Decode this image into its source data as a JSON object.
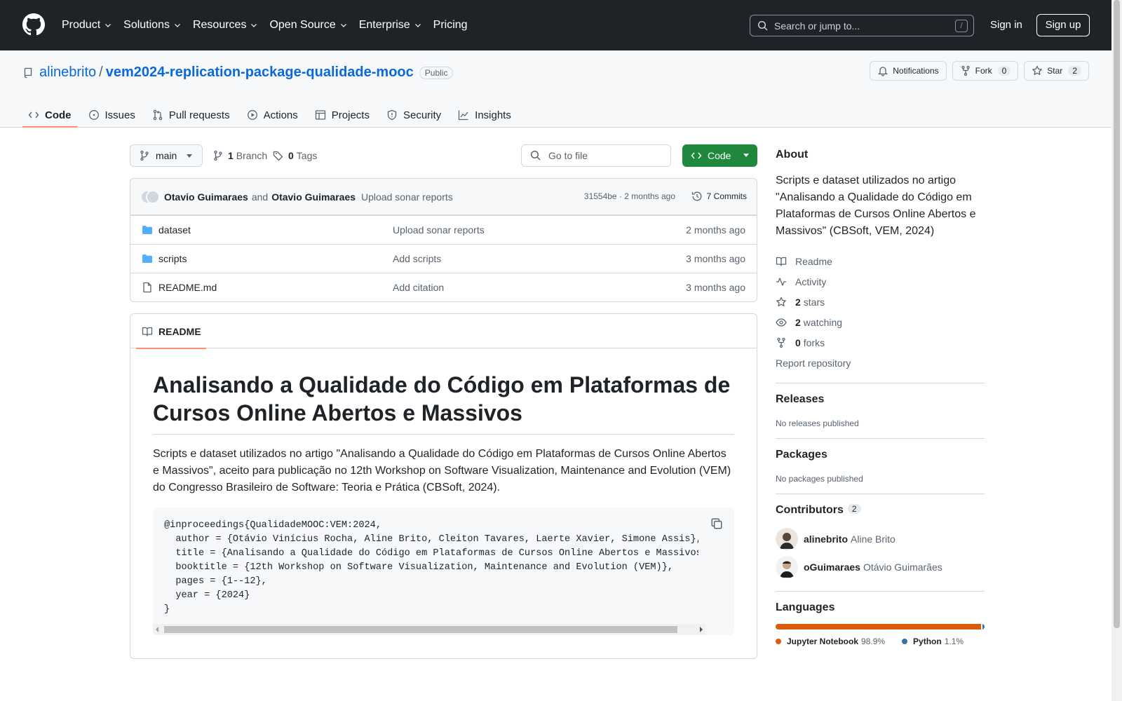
{
  "header": {
    "nav": [
      "Product",
      "Solutions",
      "Resources",
      "Open Source",
      "Enterprise",
      "Pricing"
    ],
    "search_placeholder": "Search or jump to...",
    "search_kbd": "/",
    "signin": "Sign in",
    "signup": "Sign up"
  },
  "repo": {
    "owner": "alinebrito",
    "name": "vem2024-replication-package-qualidade-mooc",
    "visibility": "Public",
    "notifications_label": "Notifications",
    "fork_label": "Fork",
    "fork_count": "0",
    "star_label": "Star",
    "star_count": "2",
    "tabs": [
      "Code",
      "Issues",
      "Pull requests",
      "Actions",
      "Projects",
      "Security",
      "Insights"
    ]
  },
  "toolbar": {
    "branch": "main",
    "branches_count": "1",
    "branches_label": "Branch",
    "tags_count": "0",
    "tags_label": "Tags",
    "goto_placeholder": "Go to file",
    "code_button": "Code"
  },
  "commit": {
    "author1": "Otavio Guimaraes",
    "and": "and",
    "author2": "Otavio Guimaraes",
    "message": "Upload sonar reports",
    "sha_time": "31554be · 2 months ago",
    "commits_label": "7 Commits"
  },
  "files": [
    {
      "type": "folder",
      "name": "dataset",
      "message": "Upload sonar reports",
      "date": "2 months ago"
    },
    {
      "type": "folder",
      "name": "scripts",
      "message": "Add scripts",
      "date": "3 months ago"
    },
    {
      "type": "file",
      "name": "README.md",
      "message": "Add citation",
      "date": "3 months ago"
    }
  ],
  "readme": {
    "tab_label": "README",
    "title": "Analisando a Qualidade do Código em Plataformas de Cursos Online Abertos e Massivos",
    "paragraph": "Scripts e dataset utilizados no artigo \"Analisando a Qualidade do Código em Plataformas de Cursos Online Abertos e Massivos\", aceito para publicação no 12th Workshop on Software Visualization, Maintenance and Evolution (VEM) do Congresso Brasileiro de Software: Teoria e Prática (CBSoft, 2024).",
    "code": "@inproceedings{QualidadeMOOC:VEM:2024,\n  author = {Otávio Vinícius Rocha, Aline Brito, Cleiton Tavares, Laerte Xavier, Simone Assis},\n  title = {Analisando a Qualidade do Código em Plataformas de Cursos Online Abertos e Massivos},\n  booktitle = {12th Workshop on Software Visualization, Maintenance and Evolution (VEM)},\n  pages = {1--12},\n  year = {2024}\n}"
  },
  "sidebar": {
    "about_title": "About",
    "about_desc": "Scripts e dataset utilizados no artigo \"Analisando a Qualidade do Código em Plataformas de Cursos Online Abertos e Massivos\" (CBSoft, VEM, 2024)",
    "readme": "Readme",
    "activity": "Activity",
    "stars_count": "2",
    "stars_label": "stars",
    "watching_count": "2",
    "watching_label": "watching",
    "forks_count": "0",
    "forks_label": "forks",
    "report": "Report repository",
    "releases_title": "Releases",
    "releases_text": "No releases published",
    "packages_title": "Packages",
    "packages_text": "No packages published",
    "contributors_title": "Contributors",
    "contributors_count": "2",
    "contributors": [
      {
        "login": "alinebrito",
        "name": "Aline Brito"
      },
      {
        "login": "oGuimaraes",
        "name": "Otávio Guimarães"
      }
    ],
    "languages_title": "Languages",
    "languages": [
      {
        "name": "Jupyter Notebook",
        "percent": "98.9%",
        "value": 98.9,
        "color": "#DA5B0B"
      },
      {
        "name": "Python",
        "percent": "1.1%",
        "value": 1.1,
        "color": "#3572A5"
      }
    ]
  }
}
